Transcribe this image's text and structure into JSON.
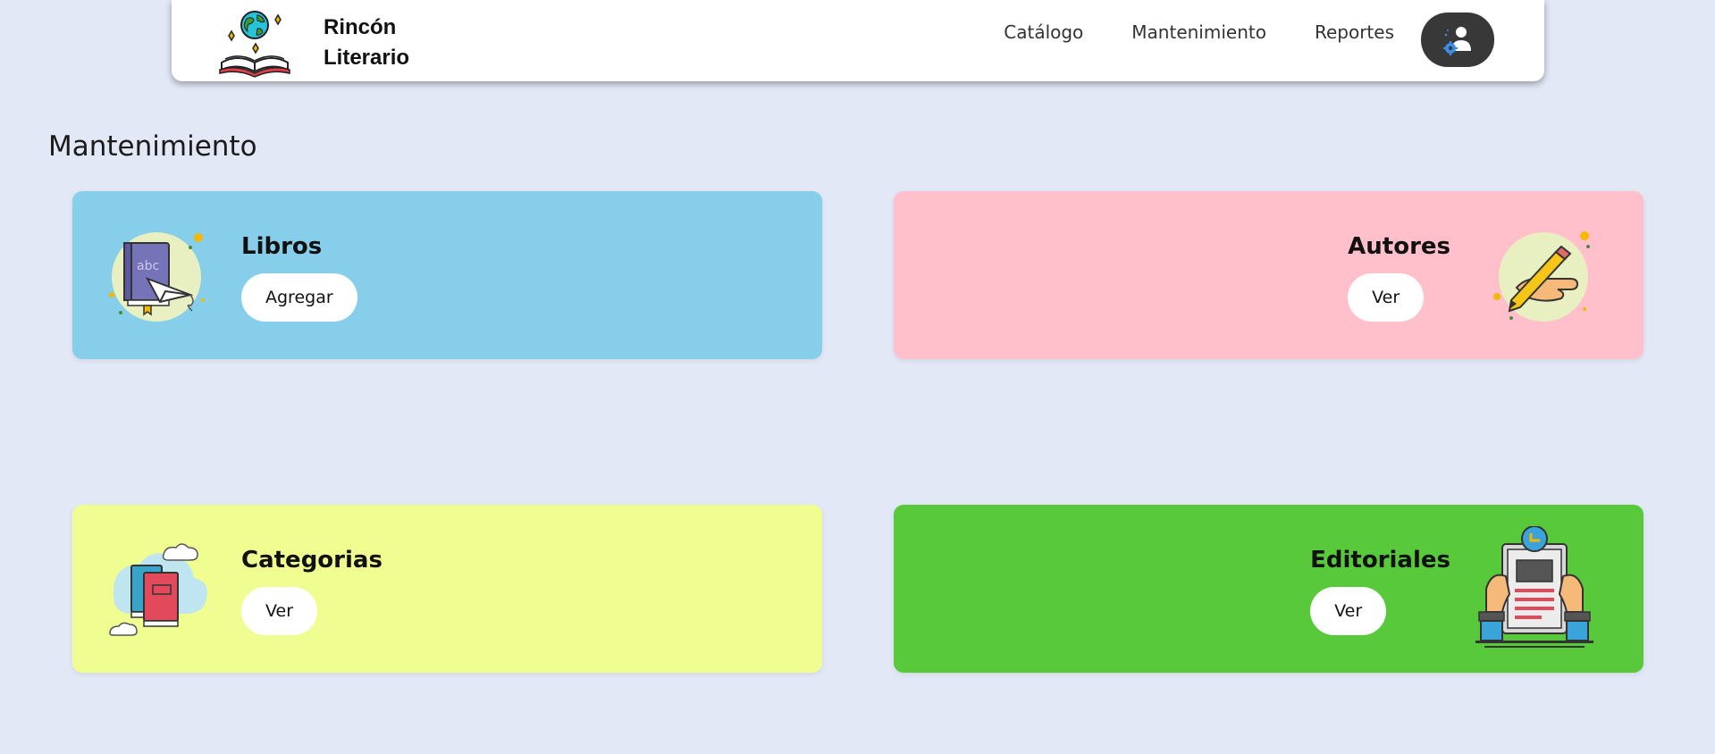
{
  "brand": {
    "name_line1": "Rincón",
    "name_line2": "Literario",
    "logo_icon": "open-book-globe-icon"
  },
  "nav": {
    "items": [
      {
        "label": "Catálogo"
      },
      {
        "label": "Mantenimiento"
      },
      {
        "label": "Reportes"
      }
    ],
    "admin_icon": "user-gear-icon"
  },
  "page": {
    "title": "Mantenimiento"
  },
  "cards": [
    {
      "title": "Libros",
      "button": "Agregar",
      "color": "#87ceea",
      "icon": "book-paper-plane-icon"
    },
    {
      "title": "Autores",
      "button": "Ver",
      "color": "#ffc0cb",
      "icon": "hand-writing-pencil-icon"
    },
    {
      "title": "Categorias",
      "button": "Ver",
      "color": "#f0fd91",
      "icon": "stacked-books-clouds-icon"
    },
    {
      "title": "Editoriales",
      "button": "Ver",
      "color": "#58c93b",
      "icon": "hands-holding-document-icon"
    }
  ]
}
